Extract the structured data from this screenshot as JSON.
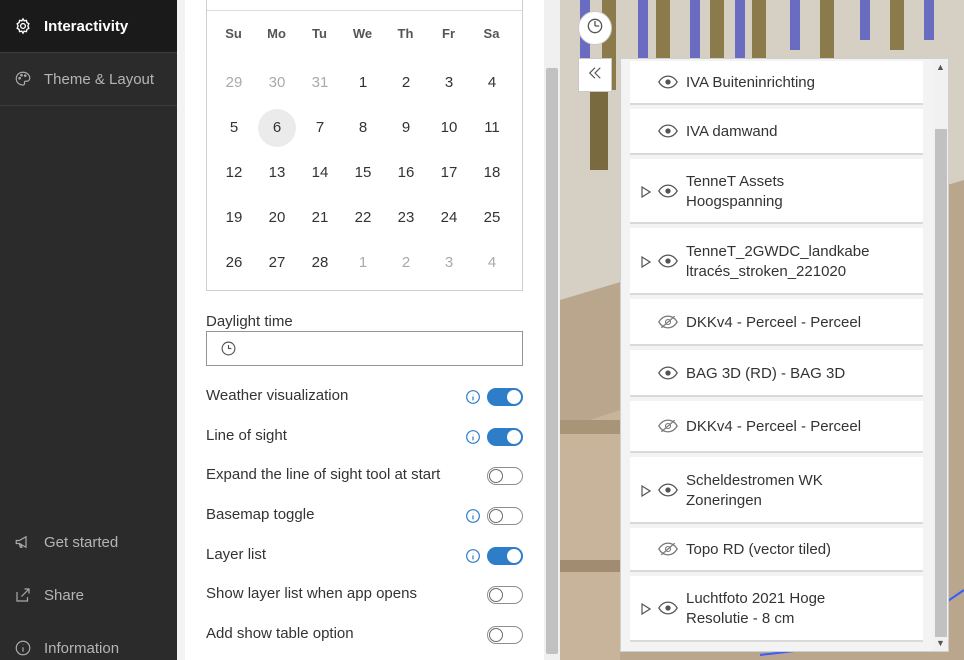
{
  "nav": {
    "items": [
      {
        "label": "Interactivity",
        "icon": "gear-icon",
        "active": true
      },
      {
        "label": "Theme & Layout",
        "icon": "palette-icon",
        "active": false
      }
    ],
    "bottom": [
      {
        "label": "Get started",
        "icon": "megaphone-icon"
      },
      {
        "label": "Share",
        "icon": "share-icon"
      },
      {
        "label": "Information",
        "icon": "info-icon"
      }
    ]
  },
  "calendar": {
    "weekdays": [
      "Su",
      "Mo",
      "Tu",
      "We",
      "Th",
      "Fr",
      "Sa"
    ],
    "weeks": [
      [
        "29",
        "30",
        "31",
        "1",
        "2",
        "3",
        "4"
      ],
      [
        "5",
        "6",
        "7",
        "8",
        "9",
        "10",
        "11"
      ],
      [
        "12",
        "13",
        "14",
        "15",
        "16",
        "17",
        "18"
      ],
      [
        "19",
        "20",
        "21",
        "22",
        "23",
        "24",
        "25"
      ],
      [
        "26",
        "27",
        "28",
        "1",
        "2",
        "3",
        "4"
      ]
    ],
    "selected": "6"
  },
  "daylight": {
    "label": "Daylight time",
    "value": ""
  },
  "settings": [
    {
      "label": "Weather visualization",
      "info": true,
      "on": true
    },
    {
      "label": "Line of sight",
      "info": true,
      "on": true
    },
    {
      "label": "Expand the line of sight tool at start",
      "info": false,
      "on": false
    },
    {
      "label": "Basemap toggle",
      "info": true,
      "on": false
    },
    {
      "label": "Layer list",
      "info": true,
      "on": true
    },
    {
      "label": "Show layer list when app opens",
      "info": false,
      "on": false
    },
    {
      "label": "Add show table option",
      "info": false,
      "on": false
    }
  ],
  "layers": [
    {
      "line1": "IVA Buiteninrichting",
      "line2": "",
      "expandable": false,
      "visible": true
    },
    {
      "line1": "IVA damwand",
      "line2": "",
      "expandable": false,
      "visible": true
    },
    {
      "line1": "TenneT Assets",
      "line2": "Hoogspanning",
      "expandable": true,
      "visible": true
    },
    {
      "line1": "TenneT_2GWDC_landkabe",
      "line2": "ltracés_stroken_221020",
      "expandable": true,
      "visible": true
    },
    {
      "line1": "DKKv4 - Perceel - Perceel",
      "line2": "",
      "expandable": false,
      "visible": false
    },
    {
      "line1": "BAG 3D (RD) - BAG 3D",
      "line2": "",
      "expandable": false,
      "visible": true
    },
    {
      "line1": "DKKv4 - Perceel - Perceel",
      "line2": "",
      "expandable": false,
      "visible": false
    },
    {
      "line1": "Scheldestromen WK",
      "line2": "Zoneringen",
      "expandable": true,
      "visible": true
    },
    {
      "line1": "Topo RD (vector tiled)",
      "line2": "",
      "expandable": false,
      "visible": false
    },
    {
      "line1": "Luchtfoto 2021 Hoge",
      "line2": "Resolutie - 8 cm",
      "expandable": true,
      "visible": true
    }
  ],
  "colors": {
    "accent": "#2e7dc8",
    "nav_bg": "#2b2b2b"
  }
}
